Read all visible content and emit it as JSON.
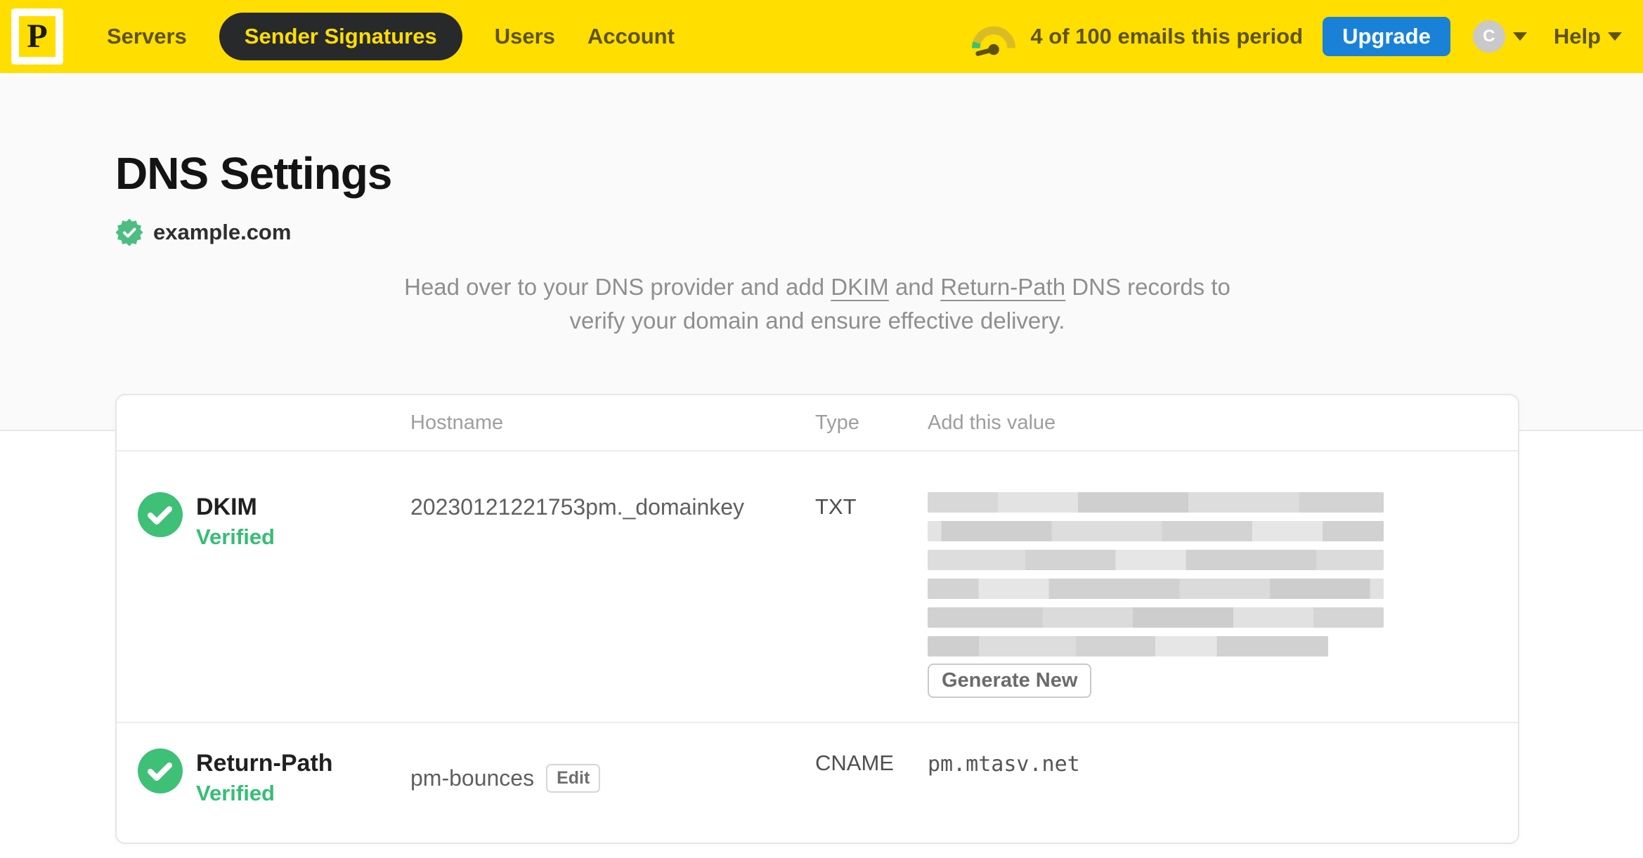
{
  "colors": {
    "brand_yellow": "#FFDE00",
    "nav_text_olive": "#5D5310",
    "active_pill_bg": "#27292B",
    "upgrade_blue": "#1982D8",
    "verified_green": "#35BE75",
    "check_circle_green": "#3EC077",
    "seal_green": "#4DBD82"
  },
  "navbar": {
    "logo_letter": "P",
    "items": [
      {
        "label": "Servers",
        "active": false
      },
      {
        "label": "Sender Signatures",
        "active": true
      },
      {
        "label": "Users",
        "active": false
      },
      {
        "label": "Account",
        "active": false
      }
    ],
    "usage_text": "4 of 100 emails this period",
    "upgrade_label": "Upgrade",
    "avatar_initial": "C",
    "help_label": "Help"
  },
  "page": {
    "title": "DNS Settings",
    "domain": "example.com",
    "description": {
      "pre": "Head over to your DNS provider and add ",
      "link_dkim": "DKIM",
      "mid": " and ",
      "link_return_path": "Return-Path",
      "tail_line1": " DNS records to",
      "tail_line2": "verify your domain and ensure effective delivery."
    }
  },
  "table": {
    "headers": {
      "hostname": "Hostname",
      "type": "Type",
      "value": "Add this value"
    },
    "rows": [
      {
        "name": "DKIM",
        "status": "Verified",
        "hostname": "20230121221753pm._domainkey",
        "type": "TXT",
        "value_redacted_rows": 6,
        "action_label": "Generate New"
      },
      {
        "name": "Return-Path",
        "status": "Verified",
        "hostname": "pm-bounces",
        "edit_label": "Edit",
        "type": "CNAME",
        "value": "pm.mtasv.net"
      }
    ]
  }
}
